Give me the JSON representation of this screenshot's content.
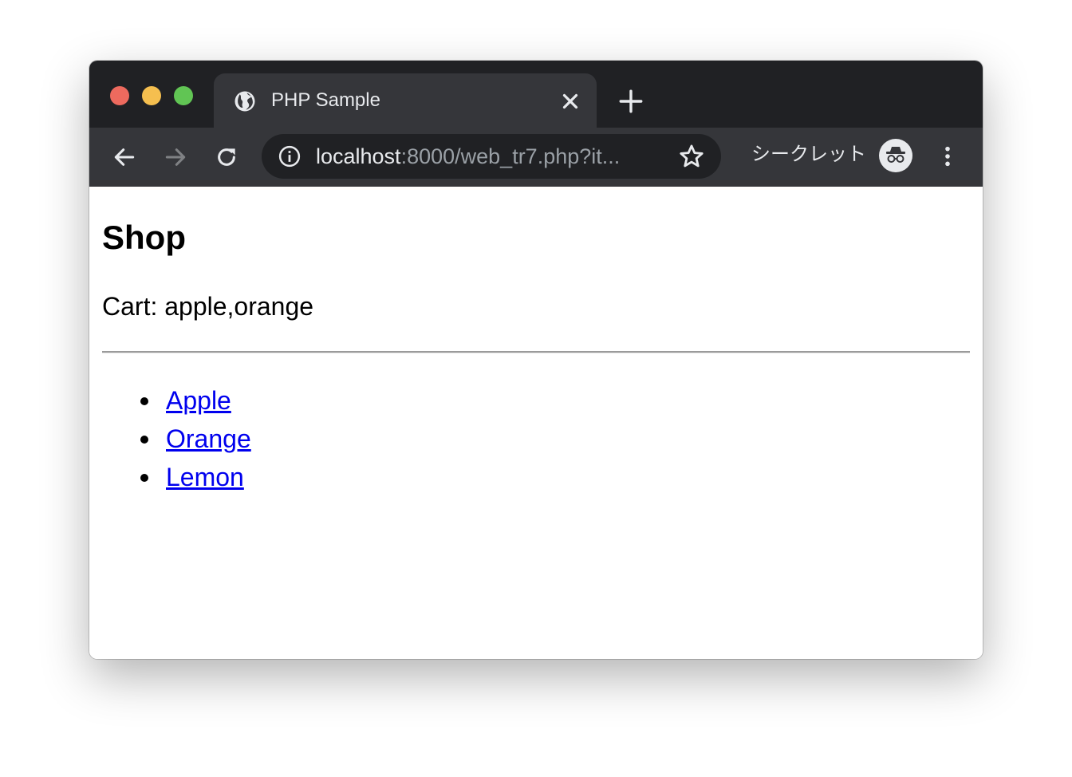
{
  "browser": {
    "tab": {
      "title": "PHP Sample",
      "favicon": "globe-icon"
    },
    "toolbar": {
      "back_icon": "back-arrow-icon",
      "forward_icon": "forward-arrow-icon",
      "reload_icon": "reload-icon",
      "url_host": "localhost",
      "url_path": ":8000/web_tr7.php?it...",
      "bookmark_icon": "star-icon",
      "incognito_label": "シークレット",
      "incognito_icon": "incognito-icon",
      "menu_icon": "kebab-menu-icon"
    },
    "colors": {
      "tabstrip": "#202124",
      "toolbar": "#35363a",
      "omnibox": "#202124",
      "close": "#ed6a5e",
      "minimize": "#f5bf4f",
      "maximize": "#61c554",
      "link": "#0000ee"
    }
  },
  "page": {
    "title": "Shop",
    "cart_text": "Cart: apple,orange",
    "items": [
      {
        "label": "Apple"
      },
      {
        "label": "Orange"
      },
      {
        "label": "Lemon"
      }
    ]
  }
}
